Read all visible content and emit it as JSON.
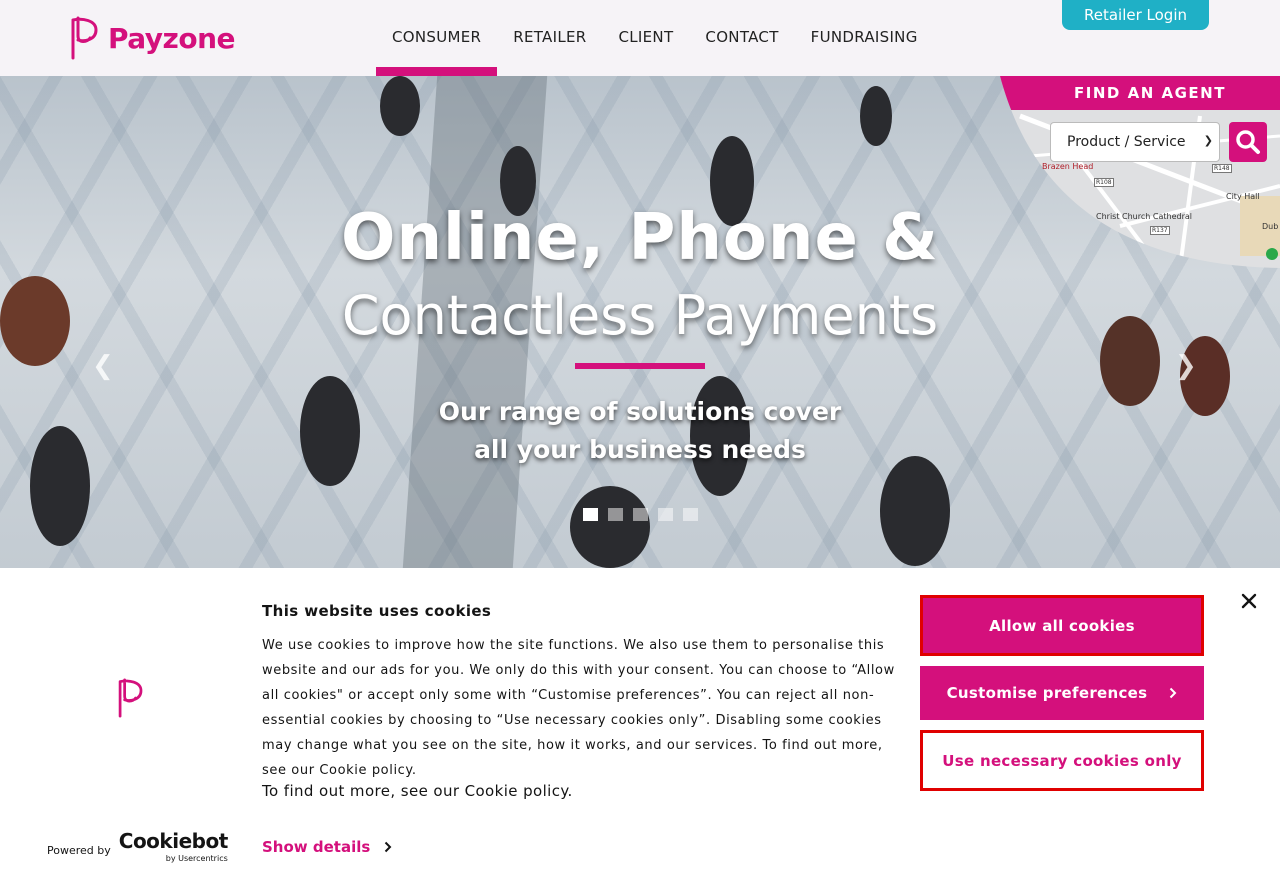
{
  "brand": {
    "name": "Payzone",
    "accent_color": "#d4107c",
    "secondary_color": "#1fb0c6"
  },
  "header": {
    "nav": [
      {
        "label": "CONSUMER",
        "active": true
      },
      {
        "label": "RETAILER",
        "active": false
      },
      {
        "label": "CLIENT",
        "active": false
      },
      {
        "label": "CONTACT",
        "active": false
      },
      {
        "label": "FUNDRAISING",
        "active": false
      }
    ],
    "retailer_login": "Retailer Login"
  },
  "hero": {
    "title_line1": "Online, Phone &",
    "title_line2": "Contactless Payments",
    "subtitle_line1": "Our range of solutions cover",
    "subtitle_line2": "all your business needs",
    "slides_count": 5,
    "active_slide": 1
  },
  "find_agent": {
    "heading": "FIND AN AGENT",
    "select_value": "Product / Service",
    "map_labels": [
      "Brazen Head",
      "Christ Church Cathedral",
      "City Hall",
      "R108",
      "R148",
      "R137",
      "Dub"
    ]
  },
  "cookie_banner": {
    "title": "This website uses cookies",
    "body": "We use cookies to improve how the site functions. We also use them to personalise this website and our ads for you. We only do this with your consent. You can choose to “Allow all cookies\" or accept only some with “Customise preferences”. You can reject all non-essential cookies by choosing to “Use necessary cookies only”. Disabling some cookies may change what you see on the site, how it works, and our services. To find out more, see our Cookie policy.",
    "body_extra": "To find out more, see our Cookie policy.",
    "show_details": "Show details",
    "powered_by": "Powered by",
    "provider": "Cookiebot",
    "provider_sub": "by Usercentrics",
    "allow_all": "Allow all cookies",
    "customise": "Customise preferences",
    "necessary_only": "Use necessary cookies only"
  }
}
